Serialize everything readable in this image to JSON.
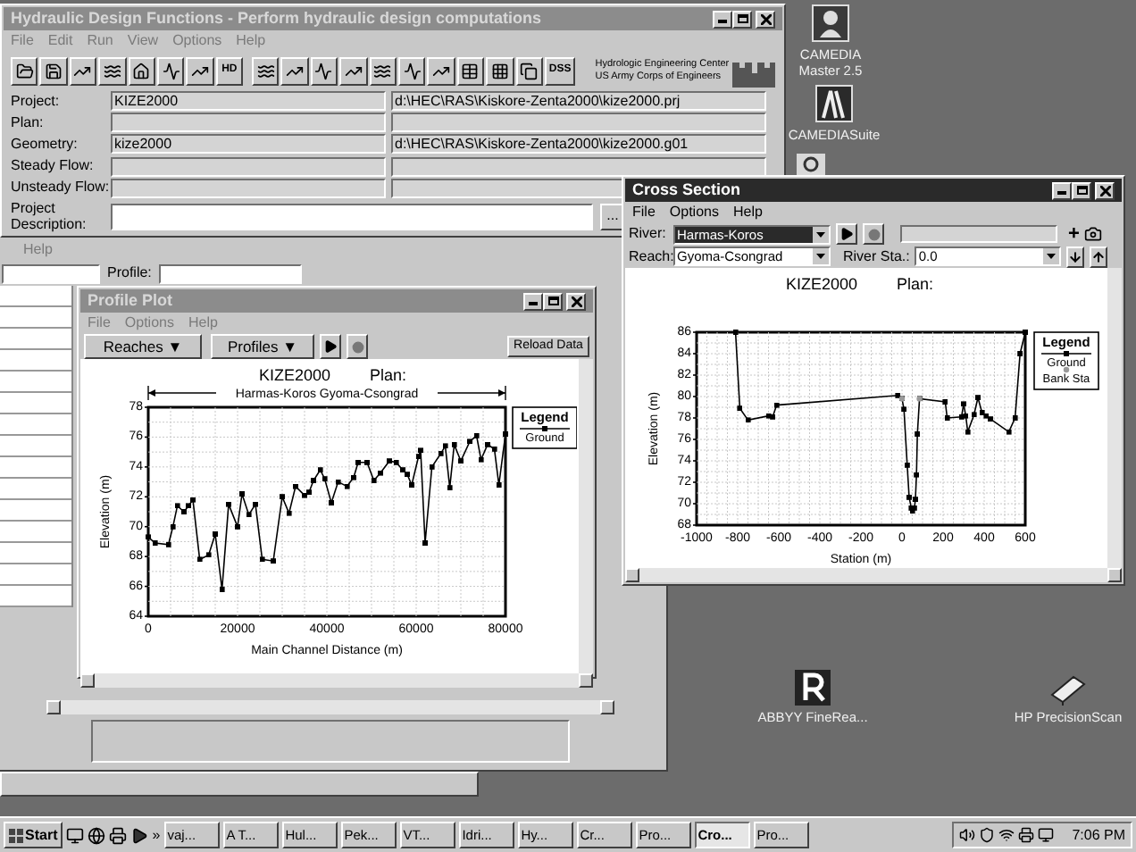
{
  "main_window": {
    "title": "Hydraulic Design Functions - Perform hydraulic design computations",
    "menu": [
      "File",
      "Edit",
      "Run",
      "View",
      "Options",
      "Help"
    ],
    "toolbar_text_buttons": {
      "hd": "HD",
      "dss": "DSS"
    },
    "logo_lines": [
      "Hydrologic Engineering Center",
      "US Army Corps of Engineers"
    ],
    "fields": [
      {
        "label": "Project:",
        "value": "KIZE2000",
        "path": "d:\\HEC\\RAS\\Kiskore-Zenta2000\\kize2000.prj"
      },
      {
        "label": "Plan:"
      },
      {
        "label": "Geometry:",
        "value": "kize2000",
        "path": "d:\\HEC\\RAS\\Kiskore-Zenta2000\\kize2000.g01"
      },
      {
        "label": "Steady Flow:"
      },
      {
        "label": "Unsteady Flow:"
      }
    ],
    "description": {
      "label": "Project Description:",
      "browse": "..."
    }
  },
  "back_window": {
    "menu": [
      "Help"
    ],
    "profile_label": "Profile:"
  },
  "profile_plot": {
    "title": "Profile Plot",
    "menu": [
      "File",
      "Options",
      "Help"
    ],
    "buttons": {
      "reaches": "Reaches ▼",
      "profiles": "Profiles ▼",
      "reload": "Reload Data"
    },
    "header": [
      "KIZE2000",
      "Plan:"
    ],
    "reach_label": "Harmas-Koros Gyoma-Csongrad",
    "legend_title": "Legend",
    "chart_data": {
      "type": "line",
      "grid": true,
      "legend": true,
      "xlabel": "Main Channel Distance (m)",
      "ylabel": "Elevation (m)",
      "xlim": [
        0,
        80000
      ],
      "ylim": [
        64,
        78
      ],
      "xticks": [
        0,
        20000,
        40000,
        60000,
        80000
      ],
      "yticks": [
        64,
        66,
        68,
        70,
        72,
        74,
        76,
        78
      ],
      "x": [
        0,
        1500,
        4500,
        5500,
        6500,
        8000,
        9000,
        10000,
        11500,
        13500,
        15000,
        16500,
        18000,
        20000,
        21000,
        22500,
        24000,
        25500,
        28000,
        30000,
        31500,
        33000,
        35000,
        36000,
        37000,
        38500,
        39500,
        41000,
        42500,
        44500,
        46000,
        47000,
        49000,
        50500,
        52000,
        54000,
        55500,
        57000,
        58000,
        59000,
        60500,
        61000,
        62000,
        63500,
        65500,
        66500,
        67500,
        68500,
        70000,
        72000,
        73500,
        74500,
        76000,
        77500,
        78500,
        80000
      ],
      "series": [
        {
          "name": "Ground",
          "color": "#000000",
          "values": [
            69.3,
            68.9,
            68.8,
            70.0,
            71.4,
            71.0,
            71.4,
            71.8,
            67.8,
            68.1,
            69.5,
            65.8,
            71.5,
            70.0,
            72.2,
            70.8,
            71.5,
            67.8,
            67.7,
            72.0,
            70.9,
            72.7,
            72.1,
            72.3,
            73.1,
            73.8,
            73.2,
            71.6,
            73.0,
            72.7,
            73.3,
            74.3,
            74.3,
            73.1,
            73.6,
            74.4,
            74.3,
            73.8,
            73.5,
            72.8,
            74.7,
            75.1,
            68.9,
            74.0,
            74.9,
            75.4,
            72.6,
            75.5,
            74.4,
            75.7,
            76.1,
            74.5,
            75.5,
            75.2,
            72.8,
            76.2
          ]
        }
      ]
    }
  },
  "cross_section": {
    "title": "Cross Section",
    "menu": [
      "File",
      "Options",
      "Help"
    ],
    "river_label": "River:",
    "river": "Harmas-Koros",
    "reach_label": "Reach:",
    "reach": "Gyoma-Csongrad",
    "station_label": "River Sta.:",
    "station": "0.0",
    "add": "+",
    "header": [
      "KIZE2000",
      "Plan:"
    ],
    "legend_title": "Legend",
    "chart_data": {
      "type": "line",
      "grid": true,
      "legend": true,
      "xlabel": "Station (m)",
      "ylabel": "Elevation (m)",
      "xlim": [
        -1000,
        600
      ],
      "ylim": [
        68,
        86
      ],
      "xticks": [
        -1000,
        -800,
        -600,
        -400,
        -200,
        0,
        200,
        400,
        600
      ],
      "yticks": [
        68,
        70,
        72,
        74,
        76,
        78,
        80,
        82,
        84,
        86
      ],
      "x": [
        -810,
        -790,
        -750,
        -650,
        -630,
        -610,
        -20,
        0,
        10,
        25,
        35,
        45,
        50,
        60,
        65,
        70,
        75,
        85,
        210,
        220,
        290,
        300,
        310,
        320,
        350,
        370,
        390,
        410,
        430,
        520,
        550,
        575,
        600
      ],
      "series": [
        {
          "name": "Ground",
          "color": "#000000",
          "values": [
            86,
            78.9,
            77.8,
            78.2,
            78.1,
            79.2,
            80.1,
            79.8,
            78.8,
            73.6,
            70.6,
            69.6,
            69.3,
            69.6,
            70.4,
            72.7,
            76.5,
            79.8,
            79.5,
            78,
            78.1,
            79.3,
            78.2,
            76.7,
            78.3,
            79.9,
            78.5,
            78.2,
            77.9,
            76.7,
            78,
            84,
            86
          ]
        },
        {
          "name": "Bank Sta",
          "type": "scatter",
          "color": "#9a9a9a",
          "values": [
            null,
            null,
            null,
            null,
            null,
            null,
            null,
            79.8,
            null,
            null,
            null,
            null,
            null,
            null,
            null,
            null,
            null,
            79.8,
            null,
            null,
            null,
            null,
            null,
            null,
            null,
            null,
            null,
            null,
            null,
            null,
            null,
            null,
            null
          ]
        }
      ]
    }
  },
  "desktop_icons": [
    {
      "label": "CAMEDIA Master 2.5"
    },
    {
      "label": "CAMEDIASuite"
    },
    {
      "label": "ABBYY FineRea..."
    },
    {
      "label": "HP PrecisionScan"
    }
  ],
  "taskbar": {
    "start": "Start",
    "more": "»",
    "tasks": [
      {
        "label": "vaj...",
        "selected": false
      },
      {
        "label": "A T...",
        "selected": false
      },
      {
        "label": "Hul...",
        "selected": false
      },
      {
        "label": "Pek...",
        "selected": false
      },
      {
        "label": "VT...",
        "selected": false
      },
      {
        "label": "Idri...",
        "selected": false
      },
      {
        "label": "Hy...",
        "selected": false
      },
      {
        "label": "Cr...",
        "selected": false
      },
      {
        "label": "Pro...",
        "selected": false
      },
      {
        "label": "Cro...",
        "selected": true
      },
      {
        "label": "Pro...",
        "selected": false
      }
    ],
    "clock": "7:06 PM"
  }
}
